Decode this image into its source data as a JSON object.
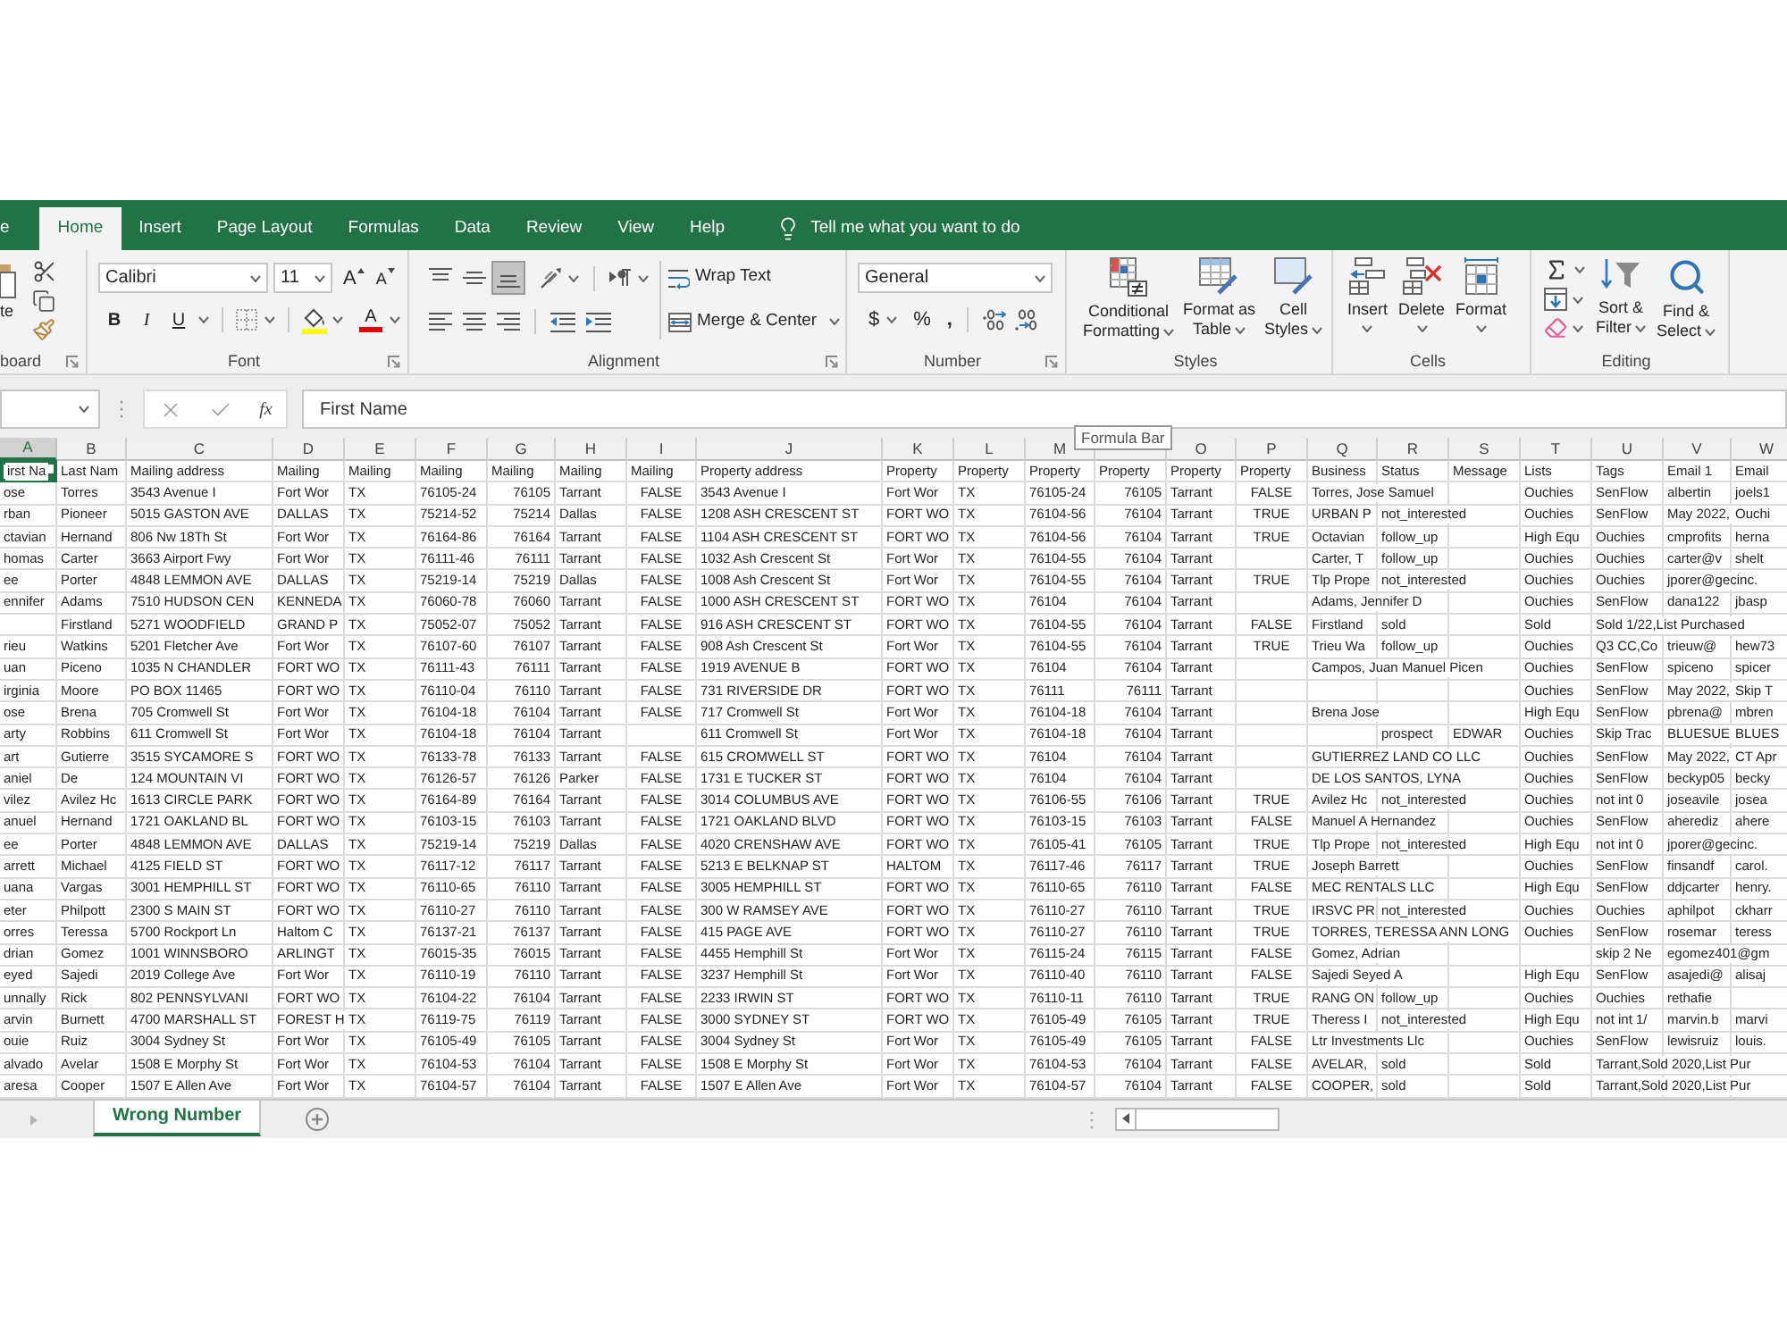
{
  "ribbon_tabs": [
    {
      "label": "e",
      "selected": false
    },
    {
      "label": "Home",
      "selected": true
    },
    {
      "label": "Insert",
      "selected": false
    },
    {
      "label": "Page Layout",
      "selected": false
    },
    {
      "label": "Formulas",
      "selected": false
    },
    {
      "label": "Data",
      "selected": false
    },
    {
      "label": "Review",
      "selected": false
    },
    {
      "label": "View",
      "selected": false
    },
    {
      "label": "Help",
      "selected": false
    }
  ],
  "tell_me": "Tell me what you want to do",
  "clipboard": {
    "paste": "te",
    "label": "board"
  },
  "font": {
    "name": "Calibri",
    "size": "11",
    "grow": "A",
    "shrink": "A",
    "bold": "B",
    "italic": "I",
    "underline": "U",
    "text_tint": "A",
    "label": "Font"
  },
  "alignment": {
    "vertical": [
      {
        "kind": "top",
        "selected": false
      },
      {
        "kind": "middle",
        "selected": false
      },
      {
        "kind": "bottom",
        "selected": true
      }
    ],
    "wrap": "Wrap Text",
    "merge": "Merge & Center",
    "label": "Alignment"
  },
  "number": {
    "format": "General",
    "currency": "$",
    "percent": "%",
    "comma": ",",
    "label": "Number"
  },
  "styles": {
    "buttons": [
      {
        "kind": "conditional",
        "lines": [
          "Conditional",
          "Formatting"
        ]
      },
      {
        "kind": "table",
        "lines": [
          "Format as",
          "Table"
        ]
      },
      {
        "kind": "cell_styles",
        "lines": [
          "Cell",
          "Styles"
        ]
      }
    ],
    "label": "Styles"
  },
  "cells_group": {
    "buttons": [
      {
        "kind": "insert",
        "label": "Insert"
      },
      {
        "kind": "delete",
        "label": "Delete"
      },
      {
        "kind": "format",
        "label": "Format"
      }
    ],
    "label": "Cells"
  },
  "editing": {
    "buttons": [
      {
        "kind": "sort",
        "lines": [
          "Sort &",
          "Filter"
        ]
      },
      {
        "kind": "find",
        "lines": [
          "Find &",
          "Select"
        ]
      }
    ],
    "label": "Editing"
  },
  "formula_bar": {
    "function": "fx",
    "value": "First Name"
  },
  "tooltip": "Formula Bar",
  "columns": [
    {
      "letter": "A",
      "kind": "text",
      "selected": true
    },
    {
      "letter": "B",
      "kind": "text",
      "selected": false
    },
    {
      "letter": "C",
      "kind": "text",
      "selected": false
    },
    {
      "letter": "D",
      "kind": "text",
      "selected": false
    },
    {
      "letter": "E",
      "kind": "text",
      "selected": false
    },
    {
      "letter": "F",
      "kind": "text",
      "selected": false
    },
    {
      "letter": "G",
      "kind": "number",
      "selected": false
    },
    {
      "letter": "H",
      "kind": "text",
      "selected": false
    },
    {
      "letter": "I",
      "kind": "boolean",
      "selected": false
    },
    {
      "letter": "J",
      "kind": "text",
      "selected": false
    },
    {
      "letter": "K",
      "kind": "text",
      "selected": false
    },
    {
      "letter": "L",
      "kind": "text",
      "selected": false
    },
    {
      "letter": "M",
      "kind": "text",
      "selected": false
    },
    {
      "kind": "number",
      "selected": false
    },
    {
      "letter": "O",
      "kind": "text",
      "selected": false
    },
    {
      "letter": "P",
      "kind": "boolean",
      "selected": false
    },
    {
      "letter": "Q",
      "kind": "text",
      "selected": false
    },
    {
      "letter": "R",
      "kind": "text",
      "selected": false
    },
    {
      "letter": "S",
      "kind": "text",
      "selected": false
    },
    {
      "letter": "T",
      "kind": "text",
      "selected": false
    },
    {
      "letter": "U",
      "kind": "text",
      "selected": false
    },
    {
      "letter": "V",
      "kind": "text",
      "selected": false
    },
    {
      "letter": "W",
      "kind": "text",
      "selected": false
    }
  ],
  "rows": [
    {
      "kind": "header",
      "selected": true,
      "cells": [
        "irst Na",
        "Last Nam",
        "Mailing address",
        "Mailing",
        "Mailing",
        "Mailing",
        "Mailing",
        "Mailing",
        "Mailing",
        "Property address",
        "Property",
        "Property",
        "Property",
        "Property",
        "Property",
        "Property",
        "Business",
        "Status",
        "Message",
        "Lists",
        "Tags",
        "Email 1",
        "Email"
      ]
    },
    {
      "kind": "data",
      "selected": false,
      "cells": [
        "ose",
        "Torres",
        "3543 Avenue I",
        "Fort Wor",
        "TX",
        "76105-24",
        "76105",
        "Tarrant",
        "FALSE",
        "3543 Avenue I",
        "Fort Wor",
        "TX",
        "76105-24",
        "76105",
        "Tarrant",
        "FALSE",
        "Torres, Jose Samuel",
        null,
        null,
        "Ouchies",
        "SenFlow",
        "albertin",
        "joels1"
      ]
    },
    {
      "kind": "data",
      "selected": false,
      "cells": [
        "rban",
        "Pioneer",
        "5015 GASTON AVE",
        "DALLAS",
        "TX",
        "75214-52",
        "75214",
        "Dallas",
        "FALSE",
        "1208 ASH CRESCENT ST",
        "FORT WO",
        "TX",
        "76104-56",
        "76104",
        "Tarrant",
        "TRUE",
        "URBAN P",
        "not_interested",
        null,
        "Ouchies",
        "SenFlow",
        "May 2022,",
        "Ouchi"
      ]
    },
    {
      "kind": "data",
      "selected": false,
      "cells": [
        "ctavian",
        "Hernand",
        "806 Nw 18Th St",
        "Fort Wor",
        "TX",
        "76164-86",
        "76164",
        "Tarrant",
        "FALSE",
        "1104 ASH CRESCENT ST",
        "FORT WO",
        "TX",
        "76104-56",
        "76104",
        "Tarrant",
        "TRUE",
        "Octavian",
        "follow_up",
        null,
        "High Equ",
        "Ouchies",
        "cmprofits",
        "herna"
      ]
    },
    {
      "kind": "data",
      "selected": false,
      "cells": [
        "homas",
        "Carter",
        "3663 Airport Fwy",
        "Fort Wor",
        "TX",
        "76111-46",
        "76111",
        "Tarrant",
        "FALSE",
        "1032 Ash Crescent St",
        "Fort Wor",
        "TX",
        "76104-55",
        "76104",
        "Tarrant",
        null,
        "Carter, T",
        "follow_up",
        null,
        "Ouchies",
        "Ouchies",
        "carter@v",
        "shelt"
      ]
    },
    {
      "kind": "data",
      "selected": false,
      "cells": [
        "ee",
        "Porter",
        "4848 LEMMON AVE",
        "DALLAS",
        "TX",
        "75219-14",
        "75219",
        "Dallas",
        "FALSE",
        "1008 Ash Crescent St",
        "Fort Wor",
        "TX",
        "76104-55",
        "76104",
        "Tarrant",
        "TRUE",
        "Tlp Prope",
        "not_interested",
        null,
        "Ouchies",
        "Ouchies",
        "jporer@gecinc.",
        null
      ]
    },
    {
      "kind": "data",
      "selected": false,
      "cells": [
        "ennifer",
        "Adams",
        "7510 HUDSON CEN",
        "KENNEDA",
        "TX",
        "76060-78",
        "76060",
        "Tarrant",
        "FALSE",
        "1000 ASH CRESCENT ST",
        "FORT WO",
        "TX",
        "76104",
        "76104",
        "Tarrant",
        null,
        "Adams, Jennifer D",
        null,
        null,
        "Ouchies",
        "SenFlow",
        "dana122",
        "jbasp"
      ]
    },
    {
      "kind": "data",
      "selected": false,
      "cells": [
        null,
        "Firstland",
        "5271 WOODFIELD",
        "GRAND P",
        "TX",
        "75052-07",
        "75052",
        "Tarrant",
        "FALSE",
        "916 ASH CRESCENT ST",
        "FORT WO",
        "TX",
        "76104-55",
        "76104",
        "Tarrant",
        "FALSE",
        "Firstland",
        "sold",
        null,
        "Sold",
        "Sold 1/22,List Purchased",
        null,
        null
      ]
    },
    {
      "kind": "data",
      "selected": false,
      "cells": [
        "rieu",
        "Watkins",
        "5201 Fletcher Ave",
        "Fort Wor",
        "TX",
        "76107-60",
        "76107",
        "Tarrant",
        "FALSE",
        "908 Ash Crescent St",
        "Fort Wor",
        "TX",
        "76104-55",
        "76104",
        "Tarrant",
        "TRUE",
        "Trieu Wa",
        "follow_up",
        null,
        "Ouchies",
        "Q3 CC,Co",
        "trieuw@",
        "hew73"
      ]
    },
    {
      "kind": "data",
      "selected": false,
      "cells": [
        "uan",
        "Piceno",
        "1035 N CHANDLER",
        "FORT WO",
        "TX",
        "76111-43",
        "76111",
        "Tarrant",
        "FALSE",
        "1919 AVENUE B",
        "FORT WO",
        "TX",
        "76104",
        "76104",
        "Tarrant",
        null,
        "Campos, Juan Manuel Picen",
        null,
        null,
        "Ouchies",
        "SenFlow",
        "spiceno",
        "spicer"
      ]
    },
    {
      "kind": "data",
      "selected": false,
      "cells": [
        "irginia",
        "Moore",
        "PO BOX 11465",
        "FORT WO",
        "TX",
        "76110-04",
        "76110",
        "Tarrant",
        "FALSE",
        "731 RIVERSIDE DR",
        "FORT WO",
        "TX",
        "76111",
        "76111",
        "Tarrant",
        null,
        null,
        null,
        null,
        "Ouchies",
        "SenFlow",
        "May 2022,",
        "Skip T"
      ]
    },
    {
      "kind": "data",
      "selected": false,
      "cells": [
        "ose",
        "Brena",
        "705 Cromwell St",
        "Fort Wor",
        "TX",
        "76104-18",
        "76104",
        "Tarrant",
        "FALSE",
        "717 Cromwell St",
        "Fort Wor",
        "TX",
        "76104-18",
        "76104",
        "Tarrant",
        null,
        "Brena Jose",
        null,
        null,
        "High Equ",
        "SenFlow",
        "pbrena@",
        "mbren"
      ]
    },
    {
      "kind": "data",
      "selected": false,
      "cells": [
        "arty",
        "Robbins",
        "611 Cromwell St",
        "Fort Wor",
        "TX",
        "76104-18",
        "76104",
        "Tarrant",
        null,
        "611 Cromwell St",
        "Fort Wor",
        "TX",
        "76104-18",
        "76104",
        "Tarrant",
        null,
        null,
        "prospect",
        "EDWAR",
        "Ouchies",
        "Skip Trac",
        "BLUESUE",
        "BLUES"
      ]
    },
    {
      "kind": "data",
      "selected": false,
      "cells": [
        "art",
        "Gutierre",
        "3515 SYCAMORE S",
        "FORT WO",
        "TX",
        "76133-78",
        "76133",
        "Tarrant",
        "FALSE",
        "615 CROMWELL ST",
        "FORT WO",
        "TX",
        "76104",
        "76104",
        "Tarrant",
        null,
        "GUTIERREZ LAND CO LLC",
        null,
        null,
        "Ouchies",
        "SenFlow",
        "May 2022,",
        "CT Apr"
      ]
    },
    {
      "kind": "data",
      "selected": false,
      "cells": [
        "aniel",
        "De",
        "124 MOUNTAIN VI",
        "FORT WO",
        "TX",
        "76126-57",
        "76126",
        "Parker",
        "FALSE",
        "1731 E TUCKER ST",
        "FORT WO",
        "TX",
        "76104",
        "76104",
        "Tarrant",
        null,
        "DE LOS SANTOS, LYNA",
        null,
        null,
        "Ouchies",
        "SenFlow",
        "beckyp05",
        "becky"
      ]
    },
    {
      "kind": "data",
      "selected": false,
      "cells": [
        "vilez",
        "Avilez Hc",
        "1613 CIRCLE PARK",
        "FORT WO",
        "TX",
        "76164-89",
        "76164",
        "Tarrant",
        "FALSE",
        "3014 COLUMBUS AVE",
        "FORT WO",
        "TX",
        "76106-55",
        "76106",
        "Tarrant",
        "TRUE",
        "Avilez Hc",
        "not_interested",
        null,
        "Ouchies",
        "not int 0",
        "joseavile",
        "josea"
      ]
    },
    {
      "kind": "data",
      "selected": false,
      "cells": [
        "anuel",
        "Hernand",
        "1721 OAKLAND BL",
        "FORT WO",
        "TX",
        "76103-15",
        "76103",
        "Tarrant",
        "FALSE",
        "1721 OAKLAND BLVD",
        "FORT WO",
        "TX",
        "76103-15",
        "76103",
        "Tarrant",
        "FALSE",
        "Manuel A Hernandez",
        null,
        null,
        "Ouchies",
        "SenFlow",
        "aherediz",
        "ahere"
      ]
    },
    {
      "kind": "data",
      "selected": false,
      "cells": [
        "ee",
        "Porter",
        "4848 LEMMON AVE",
        "DALLAS",
        "TX",
        "75219-14",
        "75219",
        "Dallas",
        "FALSE",
        "4020 CRENSHAW AVE",
        "FORT WO",
        "TX",
        "76105-41",
        "76105",
        "Tarrant",
        "TRUE",
        "Tlp Prope",
        "not_interested",
        null,
        "High Equ",
        "not int 0",
        "jporer@gecinc.",
        null
      ]
    },
    {
      "kind": "data",
      "selected": false,
      "cells": [
        "arrett",
        "Michael",
        "4125 FIELD ST",
        "FORT WO",
        "TX",
        "76117-12",
        "76117",
        "Tarrant",
        "FALSE",
        "5213 E BELKNAP ST",
        "HALTOM",
        "TX",
        "76117-46",
        "76117",
        "Tarrant",
        "TRUE",
        "Joseph Barrett",
        null,
        null,
        "Ouchies",
        "SenFlow",
        "finsandf",
        "carol."
      ]
    },
    {
      "kind": "data",
      "selected": false,
      "cells": [
        "uana",
        "Vargas",
        "3001 HEMPHILL ST",
        "FORT WO",
        "TX",
        "76110-65",
        "76110",
        "Tarrant",
        "FALSE",
        "3005 HEMPHILL ST",
        "FORT WO",
        "TX",
        "76110-65",
        "76110",
        "Tarrant",
        "FALSE",
        "MEC RENTALS LLC",
        null,
        null,
        "High Equ",
        "SenFlow",
        "ddjcarter",
        "henry."
      ]
    },
    {
      "kind": "data",
      "selected": false,
      "cells": [
        "eter",
        "Philpott",
        "2300 S MAIN ST",
        "FORT WO",
        "TX",
        "76110-27",
        "76110",
        "Tarrant",
        "FALSE",
        "300 W RAMSEY AVE",
        "FORT WO",
        "TX",
        "76110-27",
        "76110",
        "Tarrant",
        "TRUE",
        "IRSVC PR",
        "not_interested",
        null,
        "Ouchies",
        "Ouchies",
        "aphilpot",
        "ckharr"
      ]
    },
    {
      "kind": "data",
      "selected": false,
      "cells": [
        "orres",
        "Teressa",
        "5700 Rockport Ln",
        "Haltom C",
        "TX",
        "76137-21",
        "76137",
        "Tarrant",
        "FALSE",
        "415 PAGE AVE",
        "FORT WO",
        "TX",
        "76110-27",
        "76110",
        "Tarrant",
        "TRUE",
        "TORRES, TERESSA ANN LONG",
        null,
        null,
        "Ouchies",
        "SenFlow",
        "rosemar",
        "teress"
      ]
    },
    {
      "kind": "data",
      "selected": false,
      "cells": [
        "drian",
        "Gomez",
        "1001 WINNSBORO",
        "ARLINGT",
        "TX",
        "76015-35",
        "76015",
        "Tarrant",
        "FALSE",
        "4455 Hemphill St",
        "Fort Wor",
        "TX",
        "76115-24",
        "76115",
        "Tarrant",
        "FALSE",
        "Gomez, Adrian",
        null,
        null,
        null,
        "skip 2 Ne",
        "egomez401@gm",
        null
      ]
    },
    {
      "kind": "data",
      "selected": false,
      "cells": [
        "eyed",
        "Sajedi",
        "2019 College Ave",
        "Fort Wor",
        "TX",
        "76110-19",
        "76110",
        "Tarrant",
        "FALSE",
        "3237 Hemphill St",
        "Fort Wor",
        "TX",
        "76110-40",
        "76110",
        "Tarrant",
        "FALSE",
        "Sajedi Seyed A",
        null,
        null,
        "High Equ",
        "SenFlow",
        "asajedi@",
        "alisaj"
      ]
    },
    {
      "kind": "data",
      "selected": false,
      "cells": [
        "unnally",
        "Rick",
        "802 PENNSYLVANI",
        "FORT WO",
        "TX",
        "76104-22",
        "76104",
        "Tarrant",
        "FALSE",
        "2233 IRWIN ST",
        "FORT WO",
        "TX",
        "76110-11",
        "76110",
        "Tarrant",
        "TRUE",
        "RANG ON",
        "follow_up",
        null,
        "Ouchies",
        "Ouchies",
        "rethafie",
        null
      ]
    },
    {
      "kind": "data",
      "selected": false,
      "cells": [
        "arvin",
        "Burnett",
        "4700 MARSHALL ST",
        "FOREST H",
        "TX",
        "76119-75",
        "76119",
        "Tarrant",
        "FALSE",
        "3000 SYDNEY ST",
        "FORT WO",
        "TX",
        "76105-49",
        "76105",
        "Tarrant",
        "TRUE",
        "Theress I",
        "not_interested",
        null,
        "High Equ",
        "not int 1/",
        "marvin.b",
        "marvi"
      ]
    },
    {
      "kind": "data",
      "selected": false,
      "cells": [
        "ouie",
        "Ruiz",
        "3004 Sydney St",
        "Fort Wor",
        "TX",
        "76105-49",
        "76105",
        "Tarrant",
        "FALSE",
        "3004 Sydney St",
        "Fort Wor",
        "TX",
        "76105-49",
        "76105",
        "Tarrant",
        "FALSE",
        "Ltr Investments Llc",
        null,
        null,
        "Ouchies",
        "SenFlow",
        "lewisruiz",
        "louis."
      ]
    },
    {
      "kind": "data",
      "selected": false,
      "cells": [
        "alvado",
        "Avelar",
        "1508 E Morphy St",
        "Fort Wor",
        "TX",
        "76104-53",
        "76104",
        "Tarrant",
        "FALSE",
        "1508 E Morphy St",
        "Fort Wor",
        "TX",
        "76104-53",
        "76104",
        "Tarrant",
        "FALSE",
        "AVELAR,",
        "sold",
        null,
        "Sold",
        "Tarrant,Sold 2020,List Pur",
        null,
        null
      ]
    },
    {
      "kind": "data",
      "selected": false,
      "cells": [
        "aresa",
        "Cooper",
        "1507 E Allen Ave",
        "Fort Wor",
        "TX",
        "76104-57",
        "76104",
        "Tarrant",
        "FALSE",
        "1507 E Allen Ave",
        "Fort Wor",
        "TX",
        "76104-57",
        "76104",
        "Tarrant",
        "FALSE",
        "COOPER,",
        "sold",
        null,
        "Sold",
        "Tarrant,Sold 2020,List Pur",
        null,
        null
      ]
    }
  ],
  "sheets": [
    {
      "name": "Wrong Number",
      "selected": true
    }
  ]
}
